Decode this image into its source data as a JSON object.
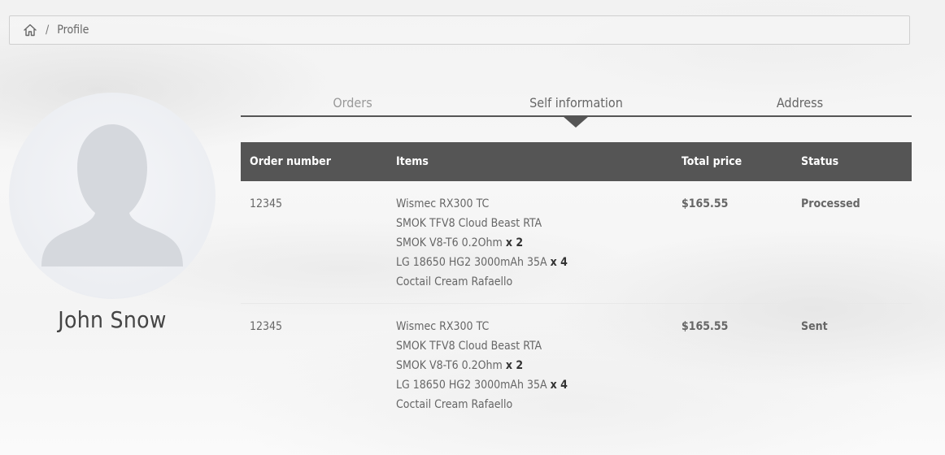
{
  "breadcrumb": {
    "home_icon": "home-icon",
    "separator": "/",
    "current": "Profile"
  },
  "profile": {
    "avatar_icon": "user-silhouette-icon",
    "name": "John Snow"
  },
  "tabs": [
    {
      "label": "Orders"
    },
    {
      "label": "Self information"
    },
    {
      "label": "Address"
    }
  ],
  "table": {
    "headers": {
      "order_number": "Order number",
      "items": "Items",
      "total_price": "Total price",
      "status": "Status"
    },
    "rows": [
      {
        "order_number": "12345",
        "items": [
          {
            "name": "Wismec RX300 TC",
            "qty": ""
          },
          {
            "name": "SMOK TFV8 Cloud Beast RTA",
            "qty": ""
          },
          {
            "name": "SMOK V8-T6 0.2Ohm",
            "qty": "x 2"
          },
          {
            "name": "LG 18650 HG2 3000mAh 35A",
            "qty": "x 4"
          },
          {
            "name": "Coctail Cream Rafaello",
            "qty": ""
          }
        ],
        "total_price": "$165.55",
        "status": "Processed",
        "status_color": "#d89a1f"
      },
      {
        "order_number": "12345",
        "items": [
          {
            "name": "Wismec RX300 TC",
            "qty": ""
          },
          {
            "name": "SMOK TFV8 Cloud Beast RTA",
            "qty": ""
          },
          {
            "name": "SMOK V8-T6 0.2Ohm",
            "qty": "x 2"
          },
          {
            "name": "LG 18650 HG2 3000mAh 35A",
            "qty": "x 4"
          },
          {
            "name": "Coctail Cream Rafaello",
            "qty": ""
          }
        ],
        "total_price": "$165.55",
        "status": "Sent",
        "status_color": "#2e7d1a"
      }
    ]
  },
  "colors": {
    "header_bg": "#555555",
    "processed": "#d89a1f",
    "sent": "#2e7d1a"
  }
}
